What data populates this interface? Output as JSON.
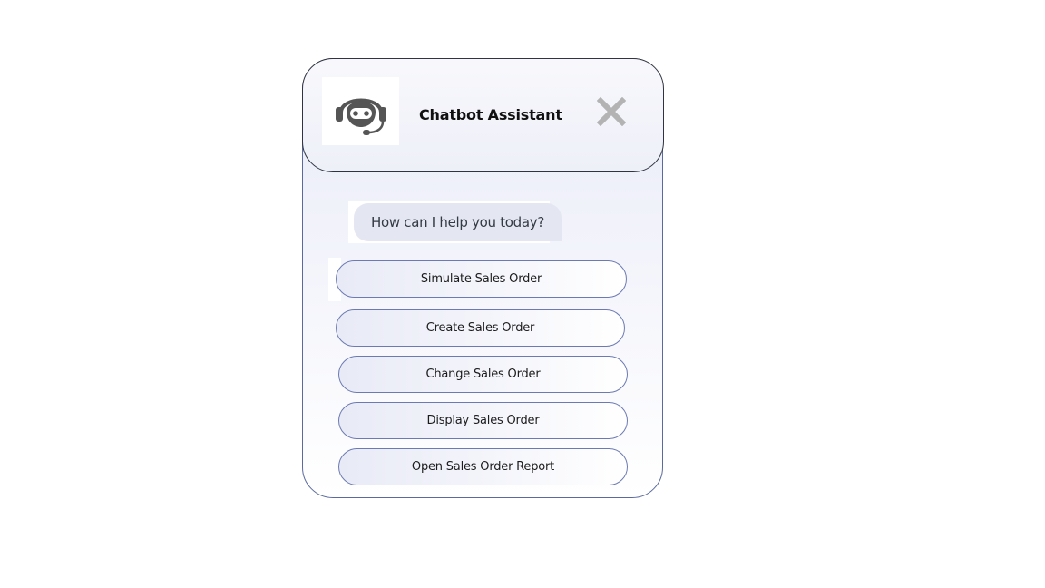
{
  "header": {
    "title": "Chatbot Assistant"
  },
  "icons": {
    "avatar": "robot-headset-icon",
    "close": "close-icon"
  },
  "message": {
    "text": "How can I help you today?"
  },
  "options": [
    {
      "label": "Simulate Sales Order"
    },
    {
      "label": "Create Sales Order"
    },
    {
      "label": "Change Sales Order"
    },
    {
      "label": "Display Sales Order"
    },
    {
      "label": "Open Sales Order Report"
    }
  ],
  "colors": {
    "border": "#6c7ab3",
    "icon": "#555555",
    "close": "#b3b3b3",
    "bubble": "#e4e7f1"
  }
}
